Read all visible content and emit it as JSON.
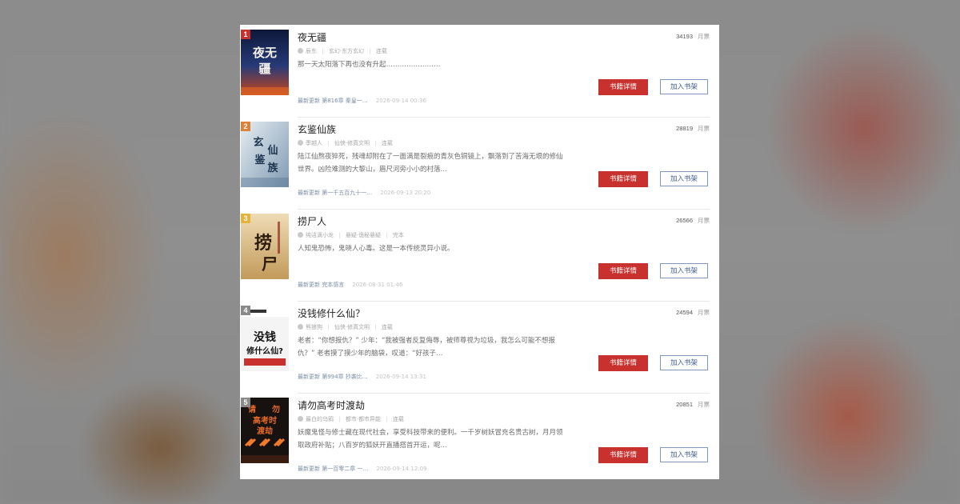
{
  "books": [
    {
      "rank": "1",
      "rank_color": "#c8312d",
      "title": "夜无疆",
      "cover_text": "夜无疆",
      "cover_colors": [
        "#0e1a3a",
        "#b33a1a"
      ],
      "author": "辰东",
      "tags": [
        "玄幻",
        "东方玄幻"
      ],
      "status": "连载",
      "description": "那一天太阳落下再也没有升起……………………",
      "latest": "最新更新 第816章 秦皇一…",
      "date": "2026-09-14 00:36",
      "votes": "34193",
      "votes_unit": "月票",
      "detail_label": "书籍详情",
      "shelf_label": "加入书架"
    },
    {
      "rank": "2",
      "rank_color": "#e0813a",
      "title": "玄鉴仙族",
      "cover_text": "玄鉴仙族",
      "cover_colors": [
        "#cfd9e2",
        "#5c7a95"
      ],
      "author": "季越人",
      "tags": [
        "仙侠",
        "修真文明"
      ],
      "status": "连载",
      "description": "陆江仙熬夜猝死，残魂却附在了一面满是裂痕的青灰色铜镜上，飘落到了苦海无垠的修仙世界。凶险难测的大黎山，眉尺河旁小小的村落…",
      "latest": "最新更新 第一千五百九十一…",
      "date": "2026-09-13 20:20",
      "votes": "28819",
      "votes_unit": "月票",
      "detail_label": "书籍详情",
      "shelf_label": "加入书架"
    },
    {
      "rank": "3",
      "rank_color": "#e6b23a",
      "title": "捞尸人",
      "cover_text": "捞尸人",
      "cover_colors": [
        "#e7cfa3",
        "#b9914f"
      ],
      "author": "纯洁滴小龙",
      "tags": [
        "悬疑",
        "诡秘悬疑"
      ],
      "status": "完本",
      "description": "人知鬼恐怖，鬼晓人心毒。这是一本传统灵异小说。",
      "latest": "最新更新 完本感言",
      "date": "2026-08-31 01:46",
      "votes": "26566",
      "votes_unit": "月票",
      "detail_label": "书籍详情",
      "shelf_label": "加入书架"
    },
    {
      "rank": "4",
      "rank_color": "#8a8a8a",
      "title": "没钱修什么仙？",
      "cover_text": "没钱修什么仙？",
      "cover_colors": [
        "#f2f2f2",
        "#222222"
      ],
      "author": "熊狼狗",
      "tags": [
        "仙侠",
        "修真文明"
      ],
      "status": "连载",
      "description": "老者：“你想报仇？” 少年：“我被强者反复侮辱，被师尊视为垃圾，我怎么可能不想报仇？” 老者摸了摸少年的脑袋，叹道：“好孩子…",
      "latest": "最新更新 第994章 抄袭比…",
      "date": "2026-09-14 13:31",
      "votes": "24594",
      "votes_unit": "月票",
      "detail_label": "书籍详情",
      "shelf_label": "加入书架"
    },
    {
      "rank": "5",
      "rank_color": "#8a8a8a",
      "title": "请勿高考时渡劫",
      "cover_text": "请勿高考时渡劫",
      "cover_colors": [
        "#1a1410",
        "#d7561f"
      ],
      "author": "最白的乌鸦",
      "tags": [
        "都市",
        "都市异能"
      ],
      "status": "连载",
      "description": "妖魔鬼怪与修士藏在现代社会，享受科技带来的便利。一千岁树妖冒充名贵古树，月月领取政府补贴；八百岁的狐妖开直播搭首开运，呢…",
      "latest": "最新更新 第一百零二章 一…",
      "date": "2026-09-14 12:09",
      "votes": "20851",
      "votes_unit": "月票",
      "detail_label": "书籍详情",
      "shelf_label": "加入书架"
    }
  ]
}
